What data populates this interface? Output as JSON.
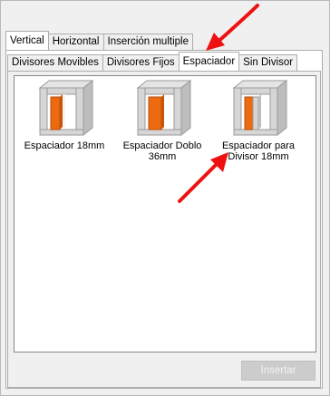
{
  "outer_tabs": [
    {
      "label": "Vertical",
      "selected": true
    },
    {
      "label": "Horizontal",
      "selected": false
    },
    {
      "label": "Inserción multiple",
      "selected": false
    }
  ],
  "inner_tabs": [
    {
      "label": "Divisores Movibles",
      "selected": false
    },
    {
      "label": "Divisores Fijos",
      "selected": false
    },
    {
      "label": "Espaciador",
      "selected": true
    },
    {
      "label": "Sin Divisor",
      "selected": false
    }
  ],
  "items": [
    {
      "label": "Espaciador 18mm",
      "icon": "spacer-cabinet-icon"
    },
    {
      "label": "Espaciador Doblo 36mm",
      "icon": "double-spacer-cabinet-icon"
    },
    {
      "label": "Espaciador para Divisor 18mm",
      "icon": "divider-spacer-cabinet-icon"
    }
  ],
  "buttons": {
    "insertar": {
      "label": "Insertar",
      "enabled": false
    }
  },
  "colors": {
    "annotation_arrow": "#ee1111",
    "spacer_orange": "#ee6a10",
    "cabinet_gray": "#cfcfcf"
  }
}
